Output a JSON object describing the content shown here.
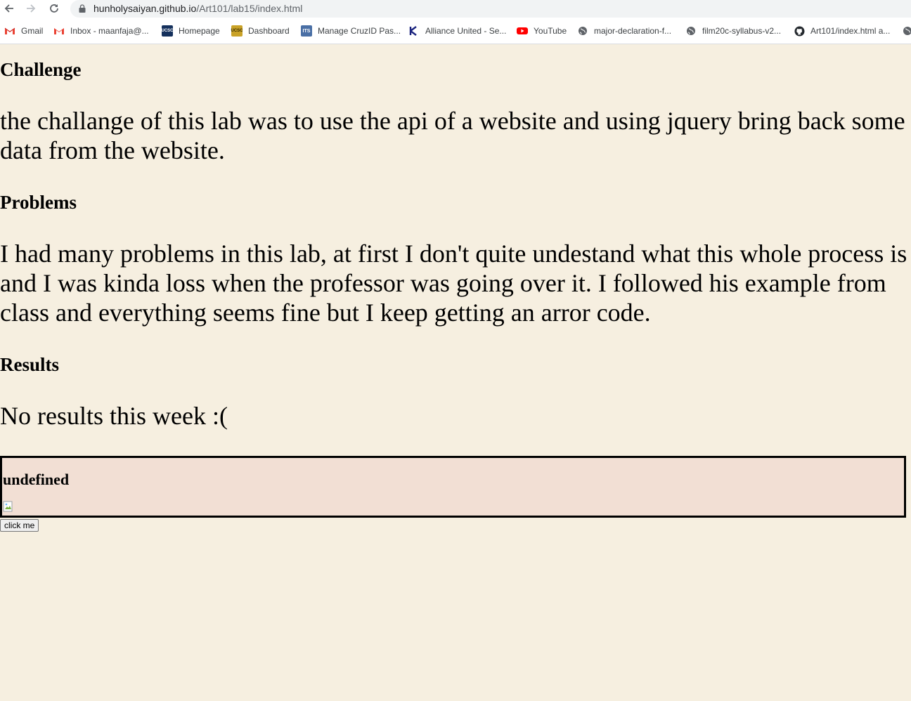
{
  "browser": {
    "url_host": "hunholysaiyan.github.io",
    "url_path": "/Art101/lab15/index.html",
    "bookmarks": [
      {
        "label": "Gmail",
        "icon": "gmail-icon"
      },
      {
        "label": "Inbox - maanfaja@...",
        "icon": "gmail-icon"
      },
      {
        "label": "Homepage",
        "icon": "ucsc-icon"
      },
      {
        "label": "Dashboard",
        "icon": "ucsc-gold-icon"
      },
      {
        "label": "Manage CruzID Pas...",
        "icon": "its-icon"
      },
      {
        "label": "Alliance United - Se...",
        "icon": "k-logo-icon"
      },
      {
        "label": "YouTube",
        "icon": "youtube-icon"
      },
      {
        "label": "major-declaration-f...",
        "icon": "globe-icon"
      },
      {
        "label": "film20c-syllabus-v2...",
        "icon": "globe-icon"
      },
      {
        "label": "Art101/index.html a...",
        "icon": "github-icon"
      }
    ],
    "icon_labels": {
      "ucsc": "UCSC",
      "its": "ITS"
    }
  },
  "page": {
    "challenge_heading": "Challenge",
    "challenge_text": "the challange of this lab was to use the api of a website and using jquery bring back some data from the website.",
    "problems_heading": "Problems",
    "problems_text": "I had many problems in this lab, at first I don't quite undestand what this whole process is and I was kinda loss when the professor was going over it. I followed his example from class and everything seems fine but I keep getting an arror code.",
    "results_heading": "Results",
    "results_text": "No results this week :(",
    "output_title": "undefined",
    "button_label": "click me"
  },
  "colors": {
    "page_background": "#f6efe0",
    "output_background": "#f2dfd4"
  }
}
